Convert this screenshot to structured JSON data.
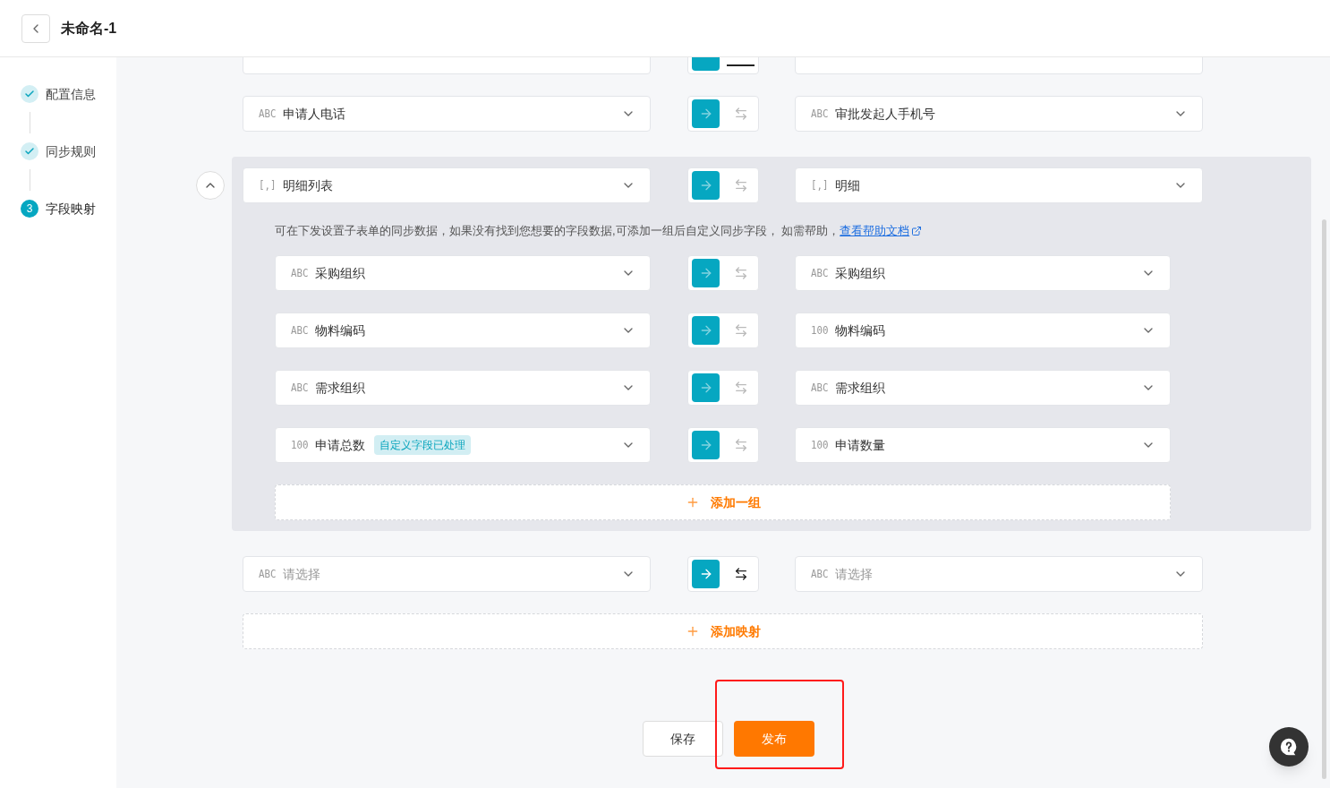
{
  "header": {
    "title": "未命名-1"
  },
  "steps": [
    {
      "label": "配置信息",
      "done": true,
      "selected": false
    },
    {
      "label": "同步规则",
      "done": true,
      "selected": false
    },
    {
      "label": "字段映射",
      "number": "3",
      "done": false,
      "selected": true
    }
  ],
  "mappings": [
    {
      "kind": "cut",
      "forward_selected": true,
      "swap_disabled": false
    },
    {
      "kind": "field",
      "source": {
        "type": "ABC",
        "name": "申请人电话"
      },
      "forward_selected": true,
      "swap_disabled": true,
      "target": {
        "type": "ABC",
        "name": "审批发起人手机号"
      }
    },
    {
      "kind": "group",
      "expanded": true,
      "source": {
        "type": "[,]",
        "name": "明细列表"
      },
      "forward_selected": true,
      "swap_disabled": true,
      "target": {
        "type": "[,]",
        "name": "明细"
      },
      "help_text": "可在下发设置子表单的同步数据，如果没有找到您想要的字段数据,可添加一组后自定义同步字段， 如需帮助，",
      "help_link": "查看帮助文档",
      "children": [
        {
          "source": {
            "type": "ABC",
            "name": "采购组织"
          },
          "forward_selected": true,
          "swap_disabled": true,
          "target": {
            "type": "ABC",
            "name": "采购组织"
          }
        },
        {
          "source": {
            "type": "ABC",
            "name": "物料编码"
          },
          "forward_selected": true,
          "swap_disabled": true,
          "target": {
            "type": "100",
            "name": "物料编码"
          }
        },
        {
          "source": {
            "type": "ABC",
            "name": "需求组织"
          },
          "forward_selected": true,
          "swap_disabled": true,
          "target": {
            "type": "ABC",
            "name": "需求组织"
          }
        },
        {
          "source": {
            "type": "100",
            "name": "申请总数",
            "tag": "自定义字段已处理"
          },
          "forward_selected": true,
          "swap_disabled": true,
          "target": {
            "type": "100",
            "name": "申请数量"
          }
        }
      ],
      "add_button": "添加一组"
    },
    {
      "kind": "field",
      "source": {
        "type": "ABC",
        "placeholder": "请选择"
      },
      "forward_selected": true,
      "swap_disabled": false,
      "target": {
        "type": "ABC",
        "placeholder": "请选择"
      }
    }
  ],
  "add_mapping": "添加映射",
  "buttons": [
    {
      "label": "保存",
      "kind": "secondary"
    },
    {
      "label": "发布",
      "kind": "primary",
      "highlighted": true
    }
  ]
}
